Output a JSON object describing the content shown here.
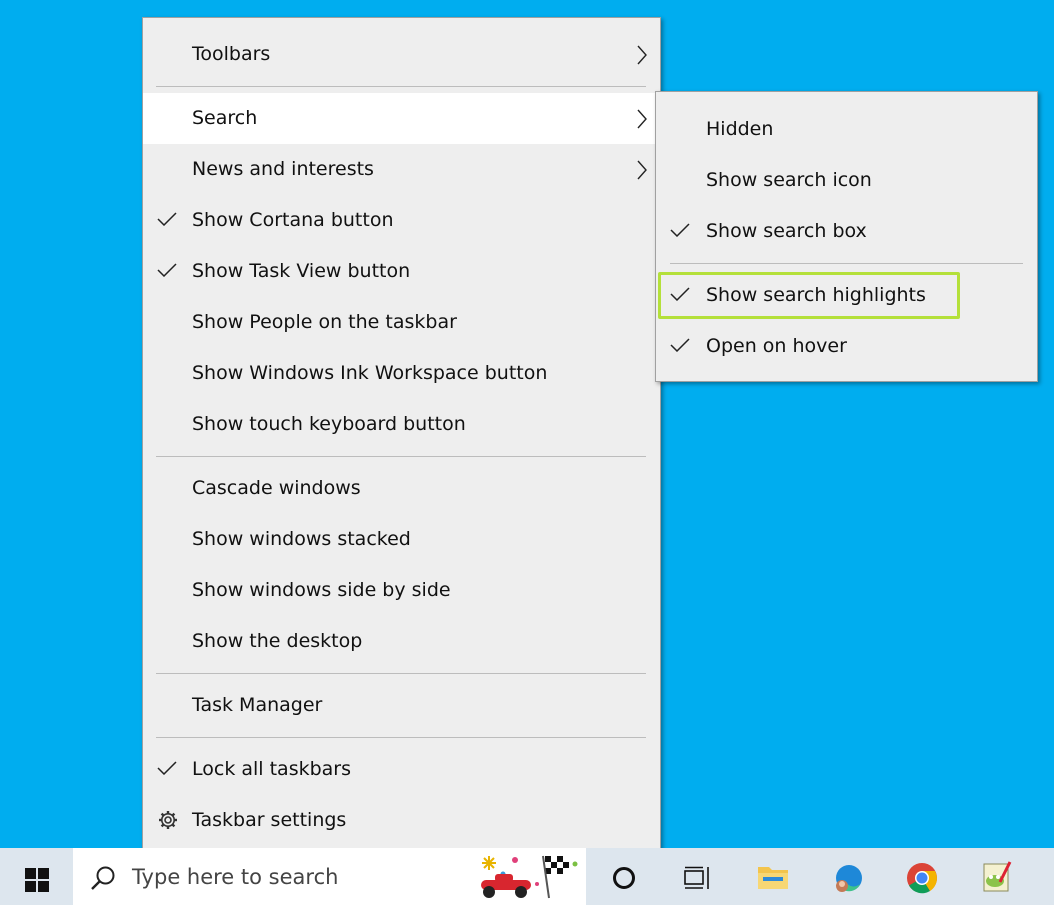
{
  "main_menu": {
    "toolbars": "Toolbars",
    "search": "Search",
    "news": "News and interests",
    "cortana": "Show Cortana button",
    "task_view": "Show Task View button",
    "people": "Show People on the taskbar",
    "ink": "Show Windows Ink Workspace button",
    "touch_keyboard": "Show touch keyboard button",
    "cascade": "Cascade windows",
    "stacked": "Show windows stacked",
    "side_by_side": "Show windows side by side",
    "desktop": "Show the desktop",
    "task_manager": "Task Manager",
    "lock": "Lock all taskbars",
    "settings": "Taskbar settings"
  },
  "search_submenu": {
    "hidden": "Hidden",
    "icon": "Show search icon",
    "box": "Show search box",
    "highlights": "Show search highlights",
    "hover": "Open on hover"
  },
  "taskbar": {
    "search_placeholder": "Type here to search"
  },
  "colors": {
    "desktop": "#00adef",
    "highlight_border": "#b4e03a",
    "menu_bg": "#eeeeee"
  }
}
